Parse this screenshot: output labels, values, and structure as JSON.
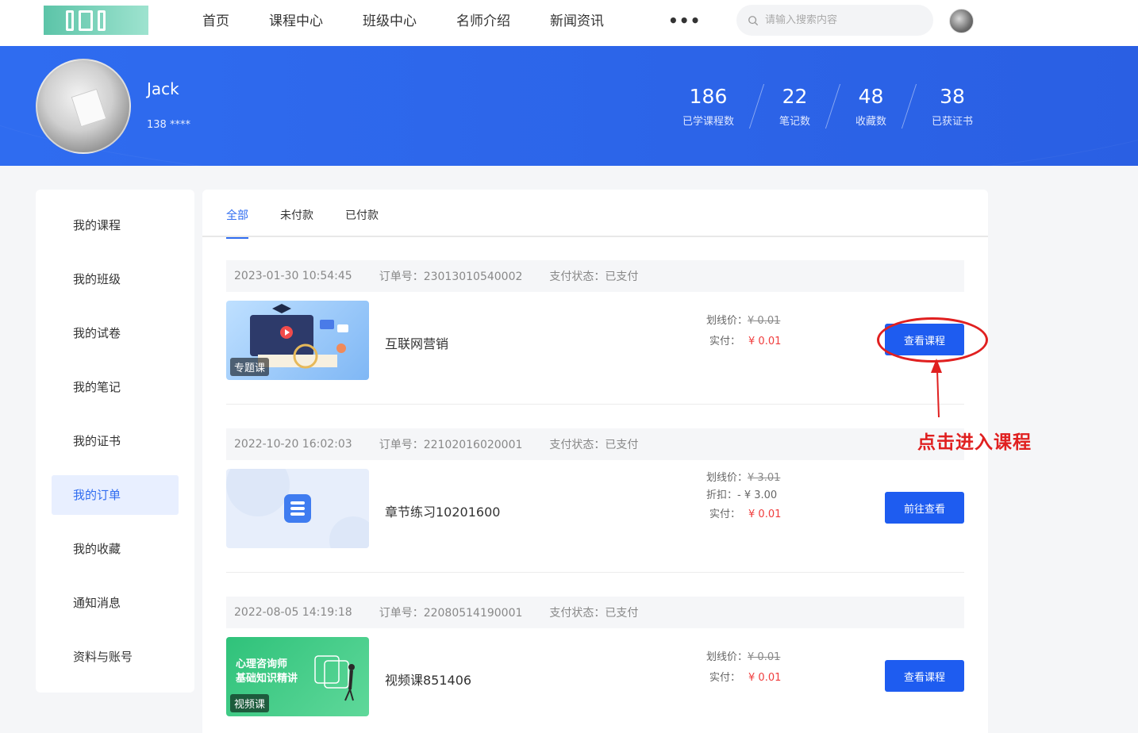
{
  "nav": {
    "items": [
      "首页",
      "课程中心",
      "班级中心",
      "名师介绍",
      "新闻资讯"
    ],
    "more": "•••"
  },
  "search": {
    "placeholder": "请输入搜索内容"
  },
  "profile": {
    "name": "Jack",
    "phone": "138 ****",
    "stats": [
      {
        "value": "186",
        "label": "已学课程数"
      },
      {
        "value": "22",
        "label": "笔记数"
      },
      {
        "value": "48",
        "label": "收藏数"
      },
      {
        "value": "38",
        "label": "已获证书"
      }
    ]
  },
  "sidebar": {
    "items": [
      "我的课程",
      "我的班级",
      "我的试卷",
      "我的笔记",
      "我的证书",
      "我的订单",
      "我的收藏",
      "通知消息",
      "资料与账号"
    ],
    "active_index": 5
  },
  "tabs": {
    "items": [
      "全部",
      "未付款",
      "已付款"
    ],
    "active_index": 0
  },
  "orders": [
    {
      "time": "2023-01-30 10:54:45",
      "order_no": "订单号：23013010540002",
      "status": "支付状态：已支付",
      "badge": "专题课",
      "name": "互联网营销",
      "list_price_label": "划线价：",
      "list_price": "¥ 0.01",
      "paid_label": "实付：",
      "paid": "¥ 0.01",
      "button": "查看课程"
    },
    {
      "time": "2022-10-20 16:02:03",
      "order_no": "订单号：22102016020001",
      "status": "支付状态：已支付",
      "name": "章节练习10201600",
      "list_price_label": "划线价：",
      "list_price": "¥ 3.01",
      "discount_label": "折扣：",
      "discount": "- ¥ 3.00",
      "paid_label": "实付：",
      "paid": "¥ 0.01",
      "button": "前往查看"
    },
    {
      "time": "2022-08-05 14:19:18",
      "order_no": "订单号：22080514190001",
      "status": "支付状态：已支付",
      "badge": "视频课",
      "thumb_title_1": "心理咨询师",
      "thumb_title_2": "基础知识精讲",
      "name": "视频课851406",
      "list_price_label": "划线价：",
      "list_price": "¥ 0.01",
      "paid_label": "实付：",
      "paid": "¥ 0.01",
      "button": "查看课程"
    }
  ],
  "annotation": {
    "text": "点击进入课程"
  },
  "colors": {
    "primary": "#2f6cf0",
    "button": "#1e5cf0",
    "price_red": "#f03c3c",
    "annotation_red": "#e02020"
  }
}
